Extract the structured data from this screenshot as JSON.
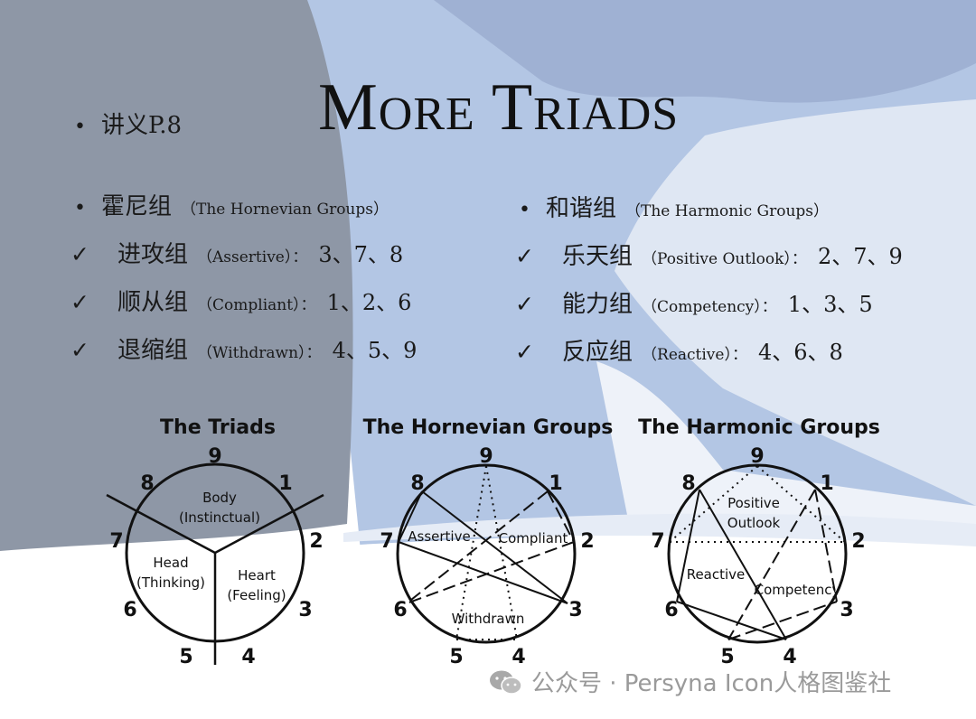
{
  "title": "More Triads",
  "handout": {
    "bullet": "•",
    "text": "讲义P.8"
  },
  "left_column": {
    "heading": {
      "bullet": "•",
      "cn": "霍尼组",
      "en": "（The Hornevian Groups）"
    },
    "items": [
      {
        "check": "✓",
        "cn": "进攻组",
        "en": "（Assertive）：",
        "nums": "3、7、8"
      },
      {
        "check": "✓",
        "cn": "顺从组",
        "en": "（Compliant）：",
        "nums": "1、2、6"
      },
      {
        "check": "✓",
        "cn": "退缩组",
        "en": "（Withdrawn）：",
        "nums": "4、5、9"
      }
    ]
  },
  "right_column": {
    "heading": {
      "bullet": "•",
      "cn": "和谐组",
      "en": "（The Harmonic Groups）"
    },
    "items": [
      {
        "check": "✓",
        "cn": "乐天组",
        "en": "（Positive Outlook）：",
        "nums": "2、7、9"
      },
      {
        "check": "✓",
        "cn": "能力组",
        "en": "（Competency）：",
        "nums": "1、3、5"
      },
      {
        "check": "✓",
        "cn": "反应组",
        "en": "（Reactive）：",
        "nums": "4、6、8"
      }
    ]
  },
  "diagrams": {
    "triads": {
      "title": "The Triads",
      "body_line1": "Body",
      "body_line2": "(Instinctual)",
      "head_line1": "Head",
      "head_line2": "(Thinking)",
      "heart_line1": "Heart",
      "heart_line2": "(Feeling)"
    },
    "hornevian": {
      "title": "The Hornevian Groups",
      "assertive": "Assertive",
      "compliant": "Compliant",
      "withdrawn": "Withdrawn"
    },
    "harmonic": {
      "title": "The Harmonic Groups",
      "positive_line1": "Positive",
      "positive_line2": "Outlook",
      "reactive": "Reactive",
      "competency": "Competency"
    },
    "numbers": [
      "9",
      "1",
      "2",
      "3",
      "4",
      "5",
      "6",
      "7",
      "8"
    ]
  },
  "footer": {
    "text": "公众号 · Persyna Icon人格图鉴社"
  },
  "colors": {
    "slate_gray": "#8e97a6",
    "light_blue": "#b3c6e4",
    "mid_blue": "#9fb1d3",
    "pale_blue": "#dfe7f3"
  }
}
